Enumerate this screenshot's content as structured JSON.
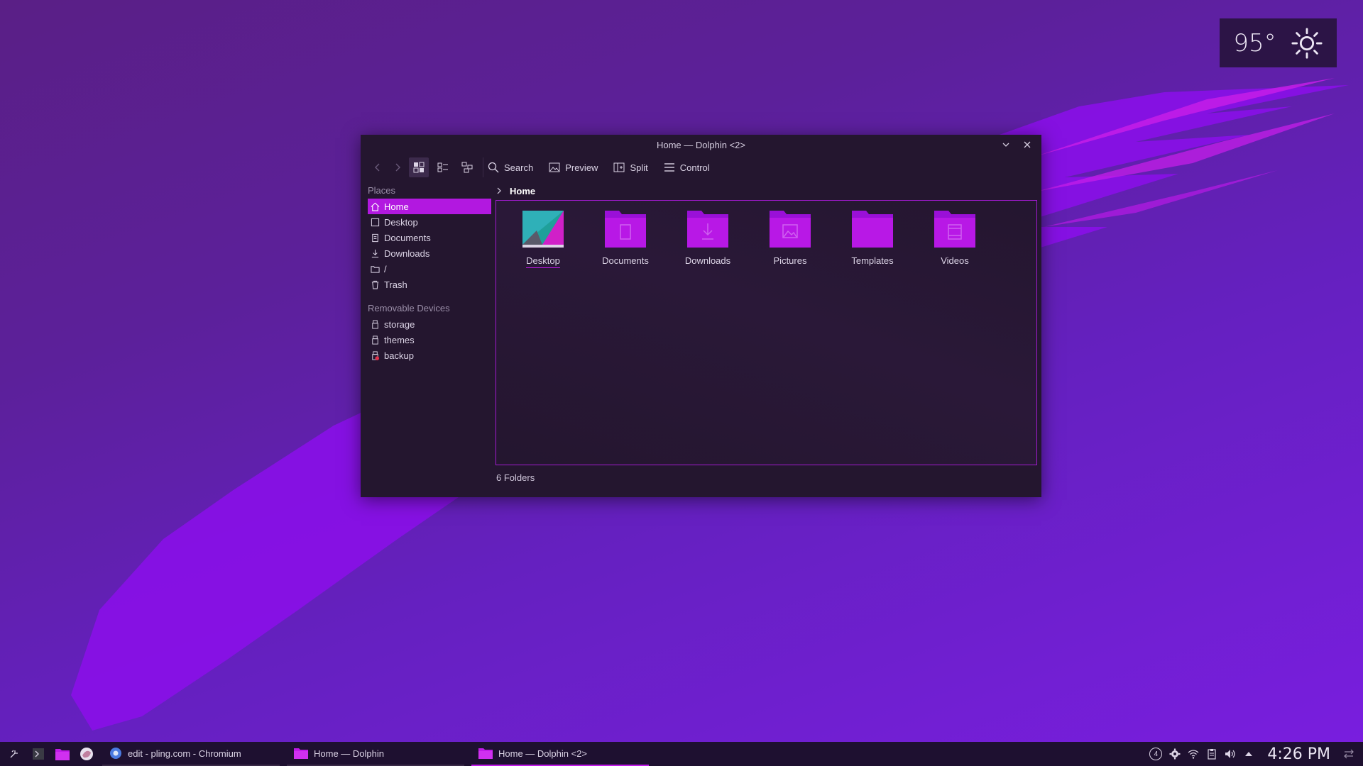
{
  "colors": {
    "accent": "#b218e0",
    "panel": "#24162f",
    "taskbar": "#1e1030",
    "weather_bg": "#2c1446"
  },
  "weather": {
    "temperature": "95°",
    "condition_icon": "sun-icon"
  },
  "window": {
    "title": "Home — Dolphin <2>",
    "toolbar": {
      "search_label": "Search",
      "preview_label": "Preview",
      "split_label": "Split",
      "control_label": "Control"
    },
    "places_heading": "Places",
    "places": [
      {
        "label": "Home",
        "icon": "home-icon",
        "selected": true
      },
      {
        "label": "Desktop",
        "icon": "desktop-icon"
      },
      {
        "label": "Documents",
        "icon": "documents-icon"
      },
      {
        "label": "Downloads",
        "icon": "downloads-icon"
      },
      {
        "label": "/",
        "icon": "folder-icon"
      },
      {
        "label": "Trash",
        "icon": "trash-icon"
      }
    ],
    "removable_heading": "Removable Devices",
    "removable": [
      {
        "label": "storage",
        "icon": "usb-icon"
      },
      {
        "label": "themes",
        "icon": "usb-icon"
      },
      {
        "label": "backup",
        "icon": "usb-unmounted-icon"
      }
    ],
    "breadcrumb": "Home",
    "files": [
      {
        "name": "Desktop",
        "icon": "desktop-folder-icon"
      },
      {
        "name": "Documents",
        "icon": "documents-folder-icon"
      },
      {
        "name": "Downloads",
        "icon": "downloads-folder-icon"
      },
      {
        "name": "Pictures",
        "icon": "pictures-folder-icon"
      },
      {
        "name": "Templates",
        "icon": "templates-folder-icon"
      },
      {
        "name": "Videos",
        "icon": "videos-folder-icon"
      }
    ],
    "status": "6 Folders"
  },
  "taskbar": {
    "tasks": [
      {
        "label": "edit - pling.com - Chromium",
        "icon": "chromium-icon"
      },
      {
        "label": "Home — Dolphin",
        "icon": "dolphin-icon"
      },
      {
        "label": "Home — Dolphin <2>",
        "icon": "dolphin-icon",
        "active": true
      }
    ],
    "clock": "4:26 PM",
    "notification_count": "4"
  }
}
